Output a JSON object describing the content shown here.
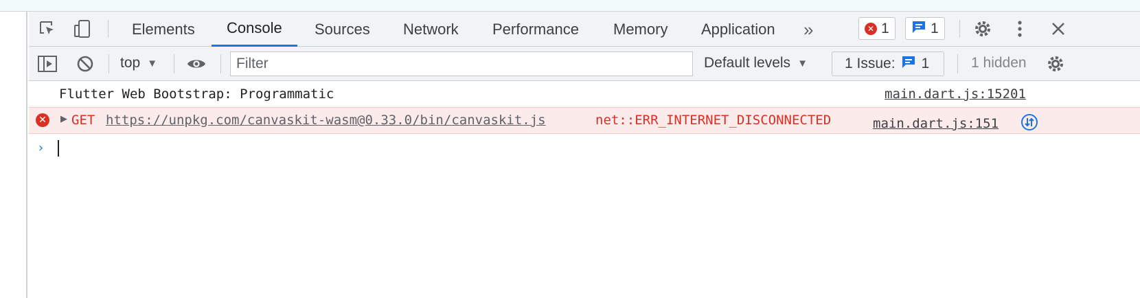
{
  "tabs": [
    {
      "label": "Elements",
      "active": false
    },
    {
      "label": "Console",
      "active": true
    },
    {
      "label": "Sources",
      "active": false
    },
    {
      "label": "Network",
      "active": false
    },
    {
      "label": "Performance",
      "active": false
    },
    {
      "label": "Memory",
      "active": false
    },
    {
      "label": "Application",
      "active": false
    }
  ],
  "more_tabs_glyph": "»",
  "counts": {
    "errors": "1",
    "messages": "1"
  },
  "toolbar": {
    "context": "top",
    "filter_placeholder": "Filter",
    "levels": "Default levels",
    "issues_label": "1 Issue:",
    "issues_count": "1",
    "hidden": "1 hidden"
  },
  "messages": [
    {
      "type": "log",
      "text": "Flutter Web Bootstrap: Programmatic",
      "source": "main.dart.js:15201"
    },
    {
      "type": "error",
      "method": "GET",
      "url": "https://unpkg.com/canvaskit-wasm@0.33.0/bin/canvaskit.js",
      "code": "net::ERR_INTERNET_DISCONNECTED",
      "source": "main.dart.js:151"
    }
  ],
  "colors": {
    "accent": "#1a73e8",
    "error": "#d93025",
    "error_bg": "#fcebeb"
  },
  "icons": [
    "inspect-element-icon",
    "device-toolbar-icon",
    "gear-icon",
    "kebab-menu-icon",
    "close-icon",
    "sidebar-toggle-icon",
    "clear-console-icon",
    "eye-icon",
    "error-icon",
    "message-icon",
    "refresh-icon"
  ]
}
